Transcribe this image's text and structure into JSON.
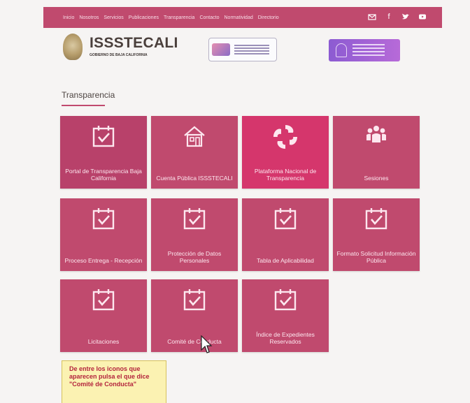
{
  "nav": {
    "links": [
      "Inicio",
      "Nosotros",
      "Servicios",
      "Publicaciones",
      "Transparencia",
      "Contacto",
      "Normatividad",
      "Directorio"
    ],
    "social": [
      "mail-icon",
      "facebook-icon",
      "twitter-icon",
      "youtube-icon"
    ]
  },
  "header": {
    "brand_title": "ISSSTECALI",
    "brand_subtitle": "",
    "brand_gov": "GOBIERNO DE BAJA CALIFORNIA"
  },
  "section": {
    "title": "Transparencia"
  },
  "tiles": [
    {
      "label": "Portal de Transparencia Baja California",
      "icon": "calendar-check-icon"
    },
    {
      "label": "Cuenta Pública ISSSTECALI",
      "icon": "house-icon"
    },
    {
      "label": "Plataforma Nacional de Transparencia",
      "icon": "platform-logo-icon"
    },
    {
      "label": "Sesiones",
      "icon": "people-icon"
    },
    {
      "label": "Proceso Entrega - Recepción",
      "icon": "calendar-check-icon"
    },
    {
      "label": "Protección de Datos Personales",
      "icon": "calendar-check-icon"
    },
    {
      "label": "Tabla de Aplicabilidad",
      "icon": "calendar-check-icon"
    },
    {
      "label": "Formato Solicitud Información Pública",
      "icon": "calendar-check-icon"
    },
    {
      "label": "Licitaciones",
      "icon": "calendar-check-icon"
    },
    {
      "label": "Comité de Conducta",
      "icon": "calendar-check-icon"
    },
    {
      "label": "Índice de Expedientes Reservados",
      "icon": "calendar-check-icon"
    }
  ],
  "hint": {
    "text": "De entre los iconos que aparecen pulsa el que dice \"Comité de Conducta\""
  },
  "colors": {
    "accent": "#c04a6e",
    "hint_bg": "#fbf2b2",
    "hint_text": "#b3233c"
  }
}
